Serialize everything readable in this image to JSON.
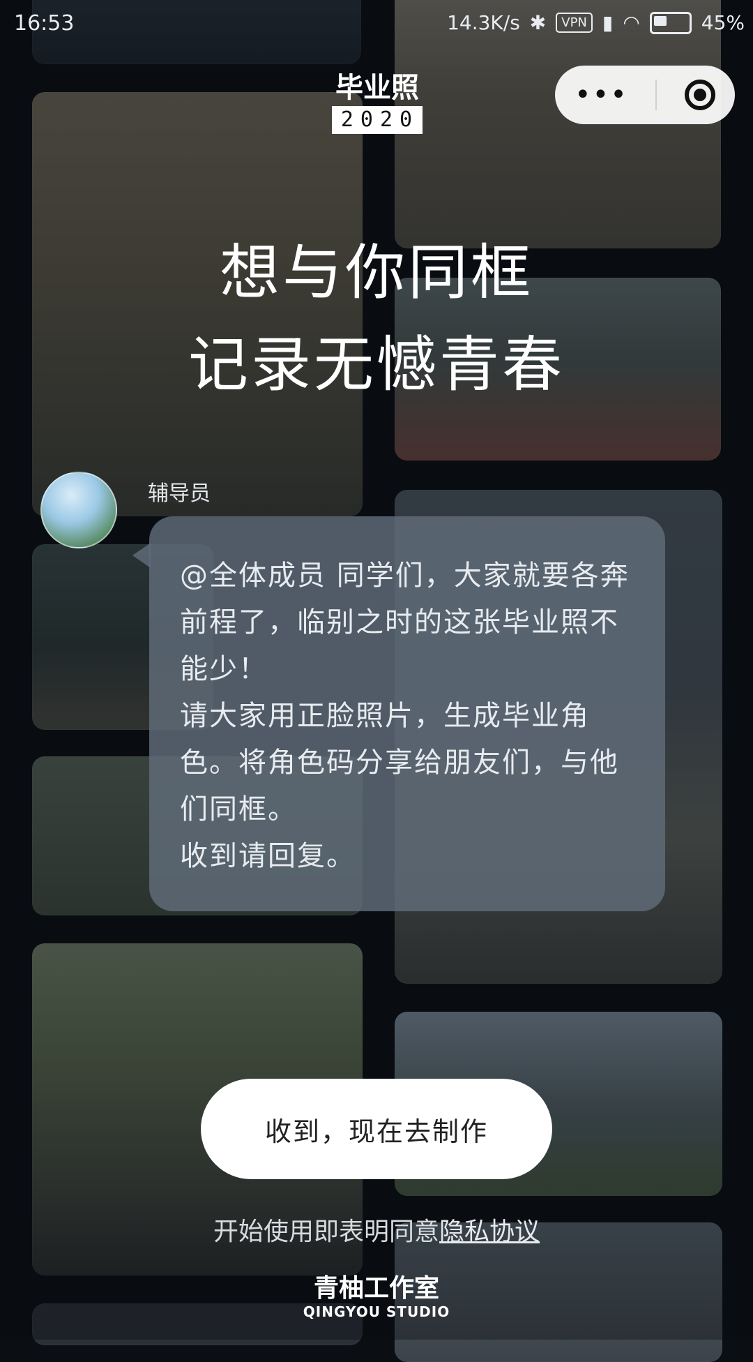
{
  "status_bar": {
    "time": "16:53",
    "network_speed": "14.3K/s",
    "vpn": "VPN",
    "battery": "45%"
  },
  "capsule": {
    "menu_label": "•••"
  },
  "logo": {
    "title": "毕业照",
    "year": "2020"
  },
  "headline": {
    "line1": "想与你同框",
    "line2": "记录无憾青春"
  },
  "message": {
    "sender": "辅导员",
    "text": "@全体成员 同学们，大家就要各奔前程了，临别之时的这张毕业照不能少！\n请大家用正脸照片，生成毕业角色。将角色码分享给朋友们，与他们同框。\n收到请回复。"
  },
  "cta": {
    "label": "收到，现在去制作"
  },
  "agreement": {
    "prefix": "开始使用即表明同意",
    "link": "隐私协议"
  },
  "footer": {
    "studio_cn": "青柚工作室",
    "studio_en": "QINGYOU STUDIO"
  }
}
